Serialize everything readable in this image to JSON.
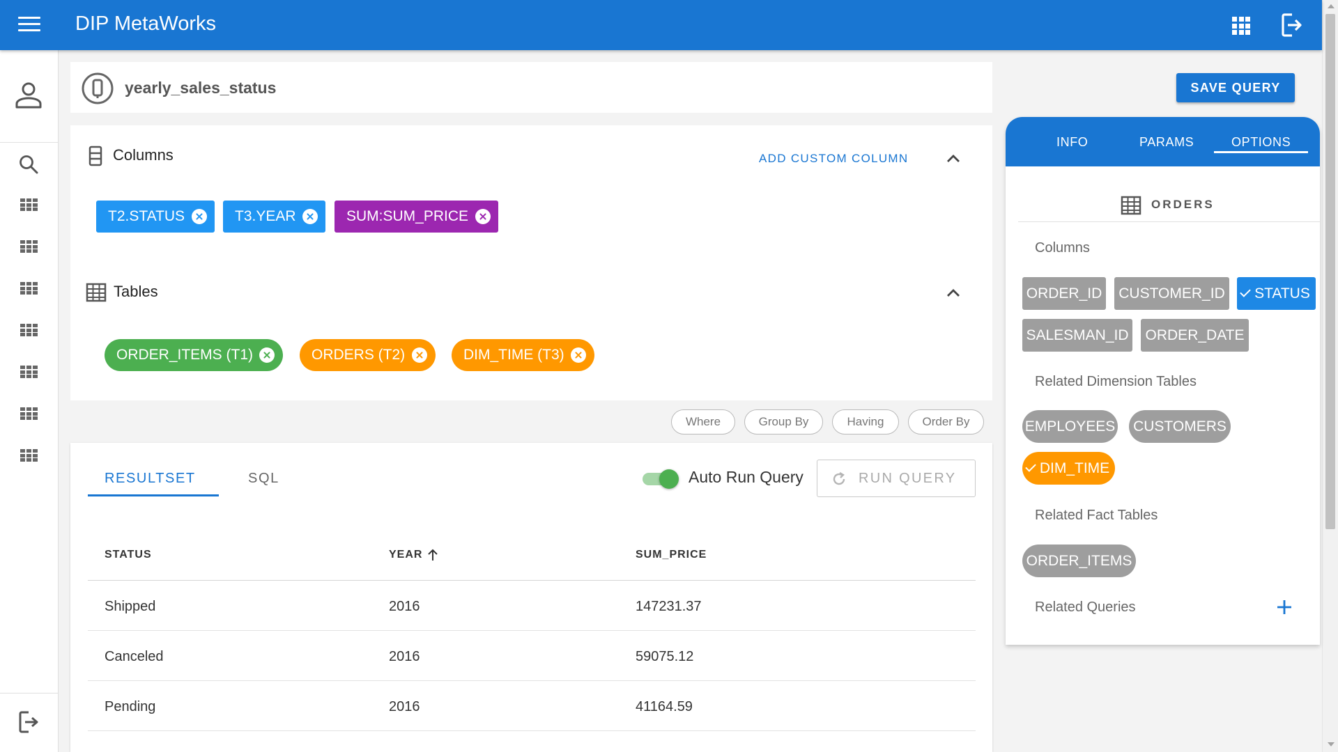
{
  "app": {
    "title": "DIP MetaWorks"
  },
  "query": {
    "name": "yearly_sales_status",
    "save_label": "SAVE QUERY"
  },
  "columns_section": {
    "title": "Columns",
    "add_custom_label": "ADD CUSTOM COLUMN",
    "chips": [
      {
        "label": "T2.STATUS",
        "color": "#2196f3"
      },
      {
        "label": "T3.YEAR",
        "color": "#2196f3"
      },
      {
        "label": "SUM:SUM_PRICE",
        "color": "#9c27b0"
      }
    ]
  },
  "tables_section": {
    "title": "Tables",
    "chips": [
      {
        "label": "ORDER_ITEMS (T1)",
        "color": "#4caf50"
      },
      {
        "label": "ORDERS (T2)",
        "color": "#ff9800"
      },
      {
        "label": "DIM_TIME (T3)",
        "color": "#ff9800"
      }
    ]
  },
  "clauses": [
    "Where",
    "Group By",
    "Having",
    "Order By"
  ],
  "results": {
    "tabs": [
      "RESULTSET",
      "SQL"
    ],
    "active_tab": "RESULTSET",
    "auto_run_label": "Auto Run Query",
    "auto_run_on": true,
    "run_label": "RUN QUERY",
    "headers": [
      "STATUS",
      "YEAR",
      "SUM_PRICE"
    ],
    "sort": {
      "column": "YEAR",
      "direction": "asc"
    },
    "rows": [
      [
        "Shipped",
        "2016",
        "147231.37"
      ],
      [
        "Canceled",
        "2016",
        "59075.12"
      ],
      [
        "Pending",
        "2016",
        "41164.59"
      ]
    ]
  },
  "panel": {
    "tabs": [
      "INFO",
      "PARAMS",
      "OPTIONS"
    ],
    "active_tab": "OPTIONS",
    "table_name": "ORDERS",
    "columns_label": "Columns",
    "columns": [
      {
        "label": "ORDER_ID",
        "selected": false
      },
      {
        "label": "CUSTOMER_ID",
        "selected": false
      },
      {
        "label": "STATUS",
        "selected": true
      },
      {
        "label": "SALESMAN_ID",
        "selected": false
      },
      {
        "label": "ORDER_DATE",
        "selected": false
      }
    ],
    "dimension_label": "Related Dimension Tables",
    "dimensions": [
      {
        "label": "EMPLOYEES",
        "selected": false
      },
      {
        "label": "CUSTOMERS",
        "selected": false
      },
      {
        "label": "DIM_TIME",
        "selected": true
      }
    ],
    "fact_label": "Related Fact Tables",
    "facts": [
      {
        "label": "ORDER_ITEMS",
        "selected": false
      }
    ],
    "queries_label": "Related Queries"
  },
  "colors": {
    "primary": "#1976d2",
    "selected_column": "#1e88e5",
    "selected_dimension": "#ff9800",
    "unselected": "#9e9e9e"
  },
  "icons": [
    "menu-icon",
    "apps-grid-icon",
    "logout-icon",
    "user-icon",
    "search-icon",
    "grid-icon",
    "query-icon",
    "columns-icon",
    "table-icon",
    "chevron-up-icon",
    "close-icon",
    "refresh-icon",
    "sort-up-icon",
    "check-icon",
    "plus-icon"
  ]
}
